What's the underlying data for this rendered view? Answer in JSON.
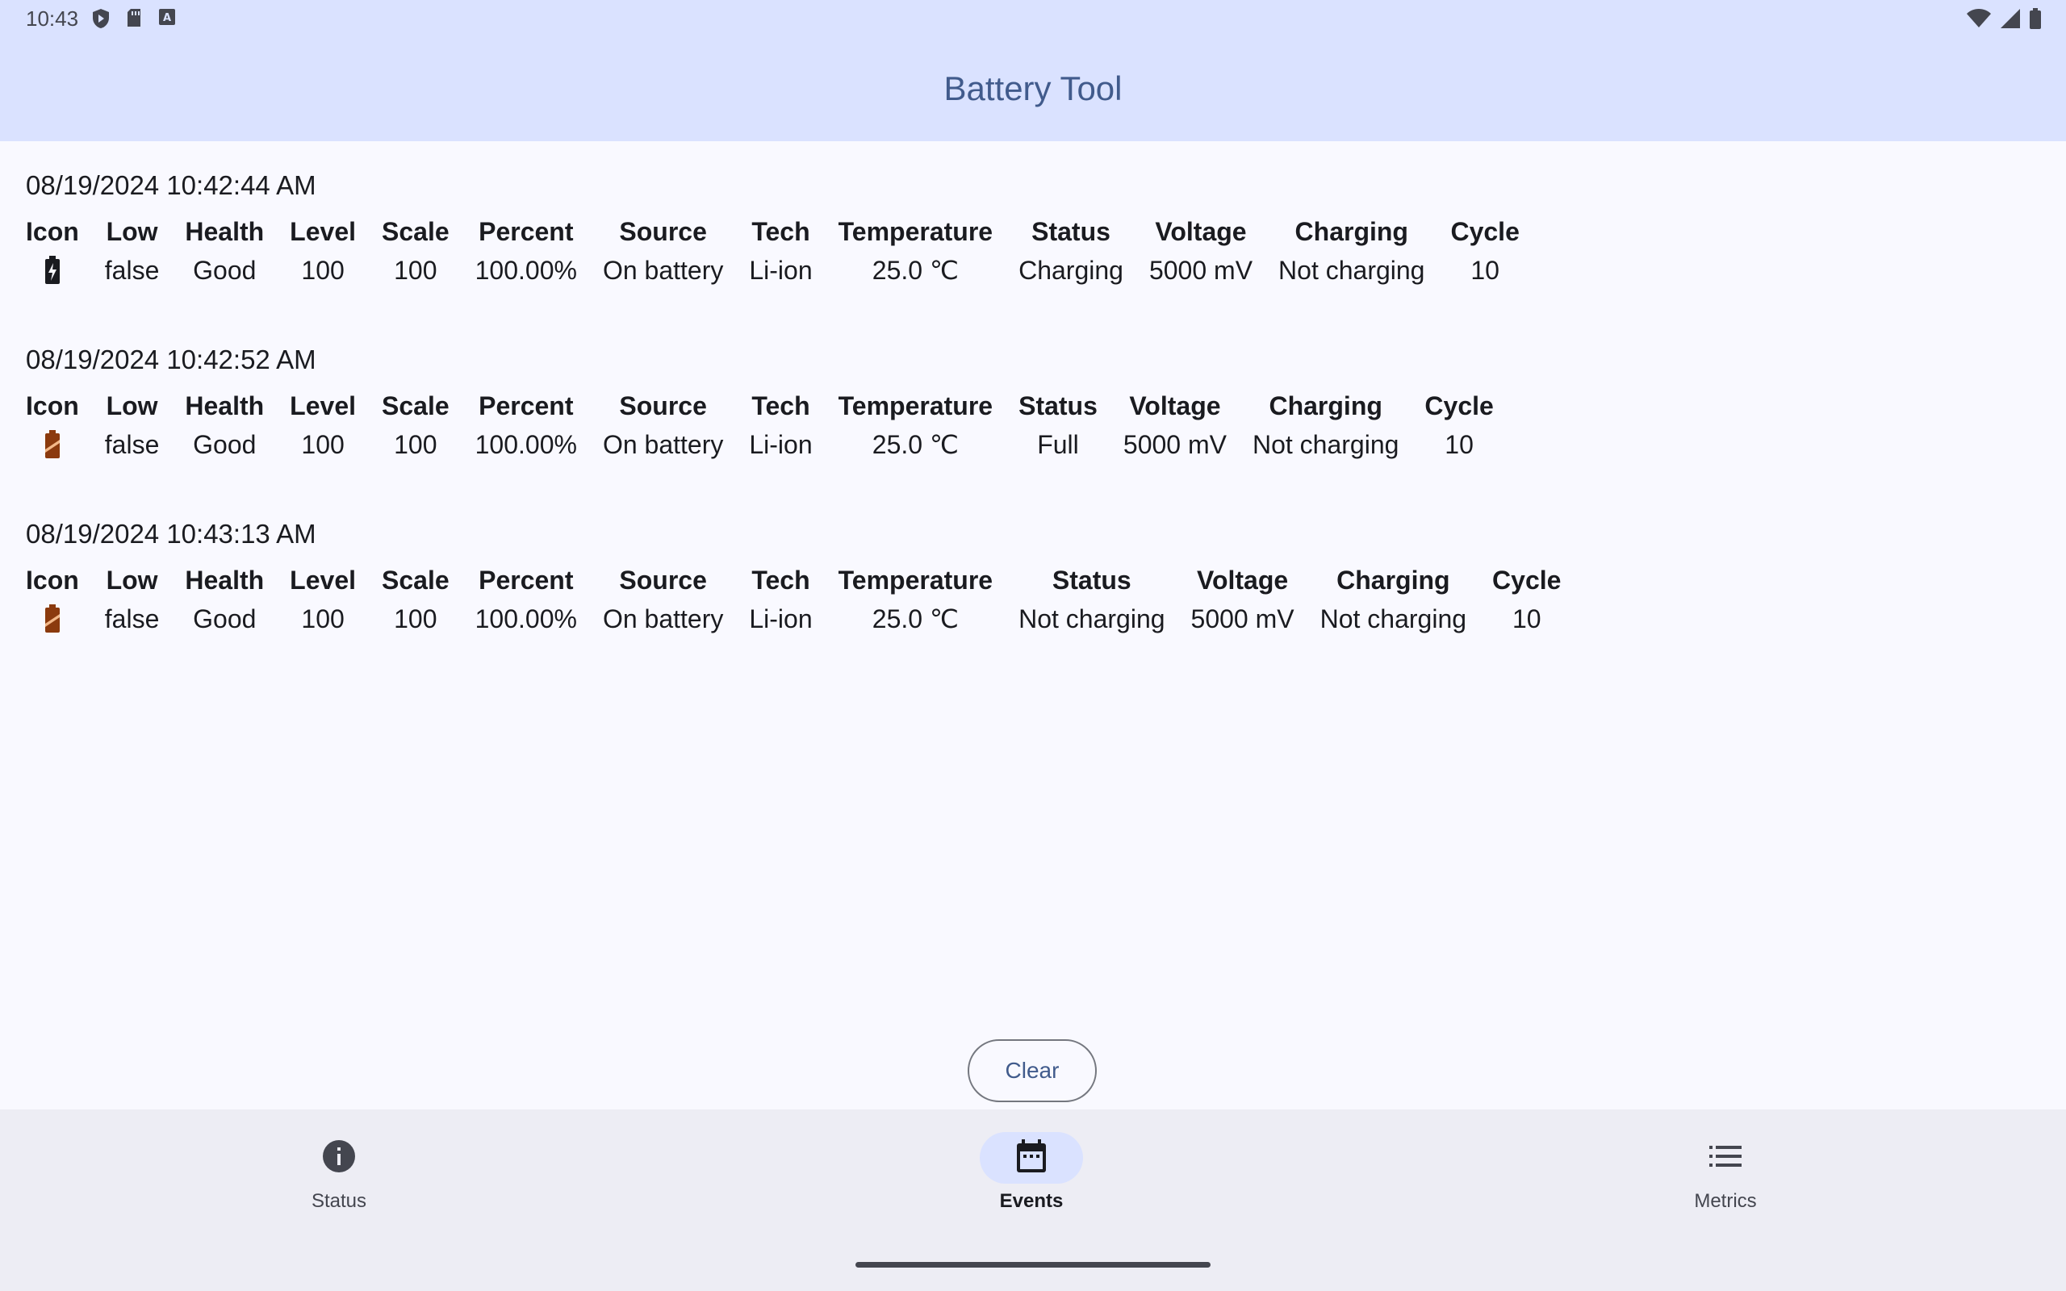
{
  "status_bar": {
    "time": "10:43"
  },
  "app_bar": {
    "title": "Battery Tool"
  },
  "headers": {
    "icon": "Icon",
    "low": "Low",
    "health": "Health",
    "level": "Level",
    "scale": "Scale",
    "percent": "Percent",
    "source": "Source",
    "tech": "Tech",
    "temperature": "Temperature",
    "status": "Status",
    "voltage": "Voltage",
    "charging": "Charging",
    "cycle": "Cycle"
  },
  "events": [
    {
      "timestamp": "08/19/2024 10:42:44 AM",
      "icon": "battery-charging-icon",
      "low": "false",
      "health": "Good",
      "level": "100",
      "scale": "100",
      "percent": "100.00%",
      "source": "On battery",
      "tech": "Li-ion",
      "temperature": "25.0 ℃",
      "status": "Charging",
      "voltage": "5000 mV",
      "charging": "Not charging",
      "cycle": "10"
    },
    {
      "timestamp": "08/19/2024 10:42:52 AM",
      "icon": "battery-alert-icon",
      "low": "false",
      "health": "Good",
      "level": "100",
      "scale": "100",
      "percent": "100.00%",
      "source": "On battery",
      "tech": "Li-ion",
      "temperature": "25.0 ℃",
      "status": "Full",
      "voltage": "5000 mV",
      "charging": "Not charging",
      "cycle": "10"
    },
    {
      "timestamp": "08/19/2024 10:43:13 AM",
      "icon": "battery-alert-icon",
      "low": "false",
      "health": "Good",
      "level": "100",
      "scale": "100",
      "percent": "100.00%",
      "source": "On battery",
      "tech": "Li-ion",
      "temperature": "25.0 ℃",
      "status": "Not charging",
      "voltage": "5000 mV",
      "charging": "Not charging",
      "cycle": "10"
    }
  ],
  "clear_button": {
    "label": "Clear"
  },
  "nav": [
    {
      "label": "Status",
      "icon": "info-icon",
      "active": false
    },
    {
      "label": "Events",
      "icon": "calendar-icon",
      "active": true
    },
    {
      "label": "Metrics",
      "icon": "list-icon",
      "active": false
    }
  ],
  "colors": {
    "app_bar_bg": "#dae2ff",
    "title_color": "#415b8c",
    "battery_charging": "#1a1b20",
    "battery_alert": "#8b3a0e"
  }
}
